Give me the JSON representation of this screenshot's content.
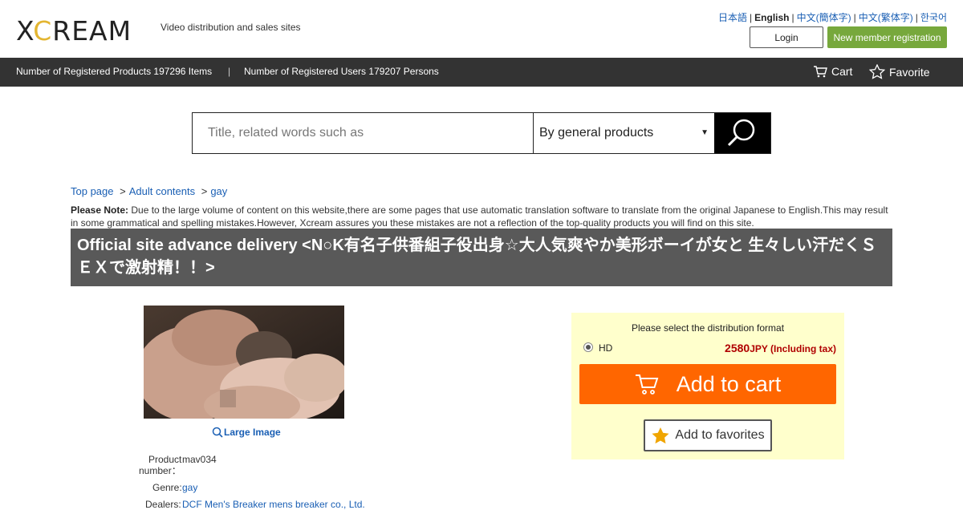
{
  "header": {
    "logo_pre": "X",
    "logo_mid": "C",
    "logo_post": "REAM",
    "tagline": "Video distribution and sales sites",
    "languages": [
      "日本語",
      "English",
      "中文(簡体字)",
      "中文(繁体字)",
      "한국어"
    ],
    "login_label": "Login",
    "register_label": "New member registration"
  },
  "statbar": {
    "products": "Number of Registered Products 197296 Items",
    "separator": "|",
    "users": "Number of Registered Users 179207 Persons",
    "cart_label": "Cart",
    "favorite_label": "Favorite"
  },
  "search": {
    "placeholder": "Title, related words such as",
    "category": "By general products"
  },
  "breadcrumb": {
    "items": [
      "Top page",
      "Adult contents",
      "gay"
    ],
    "separator": ">"
  },
  "note": {
    "label": "Please Note:",
    "text": " Due to the large volume of content on this website,there are some pages that use automatic translation software to translate from the original Japanese to English.This may result in some grammatical and spelling mistakes.However, Xcream assures you these mistakes are not a reflection of the top-quality products you will find on this site."
  },
  "product": {
    "title": "Official site advance delivery <N○K有名子供番組子役出身☆大人気爽やか美形ボーイが女と 生々しい汗だくＳＥＸで激射精！！>",
    "large_image_label": "Large Image",
    "number_label_1": "Product",
    "number_label_2": "number：",
    "number_value": "mav034",
    "genre_label": "Genre:",
    "genre_value": "gay",
    "dealers_label": "Dealers:",
    "dealers_value": "DCF Men's Breaker mens breaker co., Ltd."
  },
  "purchase": {
    "prompt": "Please select the distribution format",
    "format": "HD",
    "price": "2580",
    "price_suffix": "JPY (Including tax)",
    "add_to_cart": "Add to cart",
    "add_to_favorites": "Add to favorites"
  },
  "colors": {
    "accent_orange": "#ff6600",
    "register_green": "#77a83c",
    "title_gray": "#595959",
    "buybox_yellow": "#ffffcc",
    "link_blue": "#1a5fb4"
  }
}
